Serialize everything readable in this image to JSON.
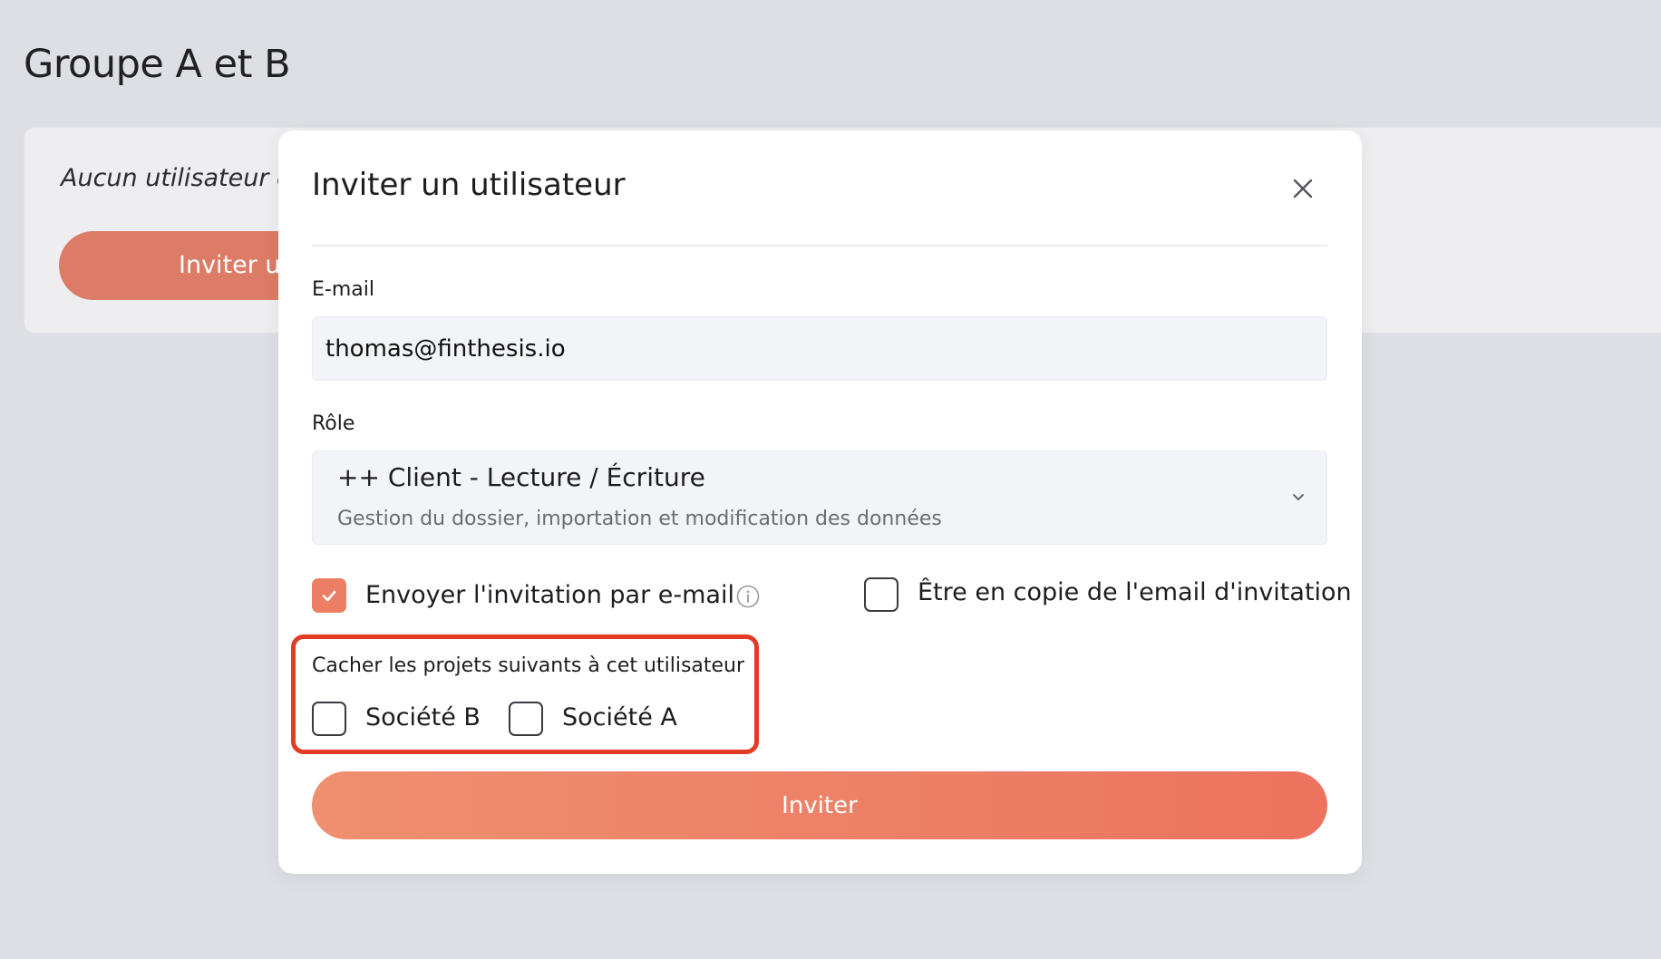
{
  "page": {
    "title": "Groupe A et B"
  },
  "background_card": {
    "empty_text": "Aucun utilisateur e",
    "invite_button": "Inviter un u"
  },
  "modal": {
    "title": "Inviter un utilisateur",
    "close_icon": "close-icon",
    "email": {
      "label": "E-mail",
      "value": "thomas@finthesis.io"
    },
    "role": {
      "label": "Rôle",
      "selected": "++ Client - Lecture / Écriture",
      "description": "Gestion du dossier, importation et modification des données"
    },
    "send_invite": {
      "label": "Envoyer l'invitation par e-mail",
      "checked": true
    },
    "cc_email": {
      "label": "Être en copie de l'email d'invitation",
      "checked": false
    },
    "hide_projects": {
      "label": "Cacher les projets suivants à cet utilisateur",
      "options": [
        {
          "label": "Société B",
          "checked": false
        },
        {
          "label": "Société A",
          "checked": false
        }
      ]
    },
    "submit_label": "Inviter"
  },
  "colors": {
    "accent": "#ec7f63",
    "highlight_border": "#e23a23",
    "background": "#dedfe4"
  }
}
